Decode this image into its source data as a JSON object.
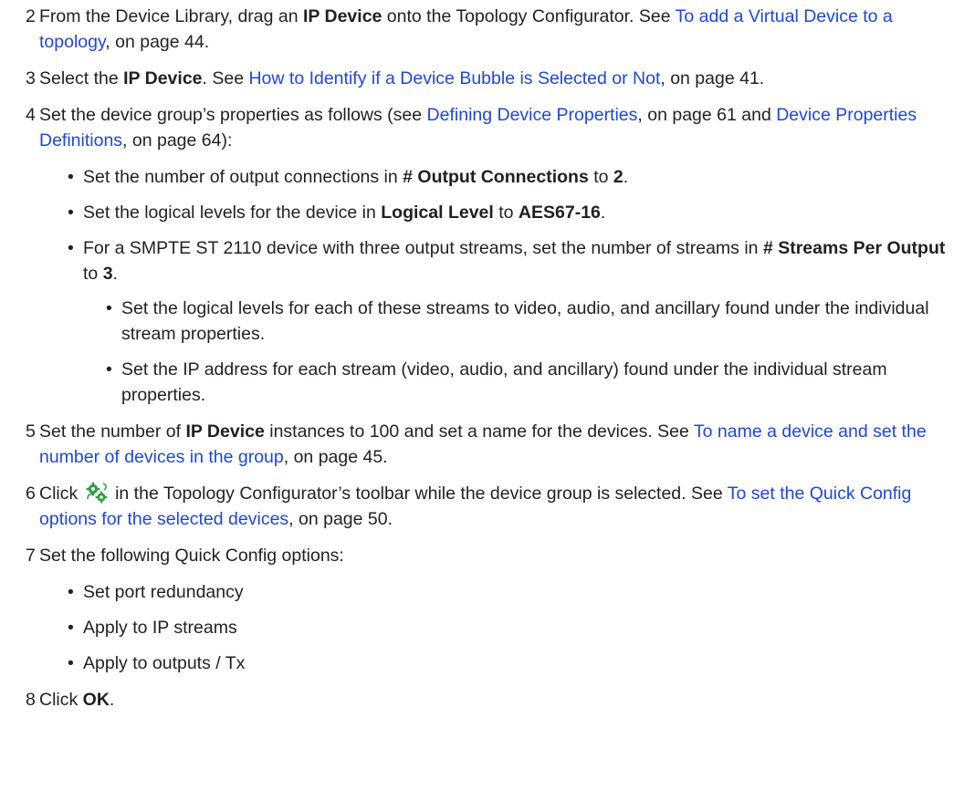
{
  "steps": [
    {
      "num": "2",
      "t1": "From the Device Library, drag an ",
      "b1": "IP Device",
      "t2": " onto the Topology Configurator. See ",
      "link": "To add a Virtual Device to a topology",
      "t3": ", on page 44."
    },
    {
      "num": "3",
      "t1": "Select the ",
      "b1": "IP Device",
      "t2": ". See ",
      "link": "How to Identify if a Device Bubble is Selected or Not",
      "t3": ", on page 41."
    },
    {
      "num": "4",
      "t1": "Set the device group’s properties as follows (see ",
      "link1": "Defining Device Properties",
      "t2": ", on page 61 and ",
      "link2": "Device Properties Definitions",
      "t3": ", on page 64):",
      "bullets": [
        {
          "t1": "Set the number of output connections in ",
          "b1": "# Output Connections",
          "t2": " to ",
          "b2": "2",
          "t3": "."
        },
        {
          "t1": "Set the logical levels for the device in ",
          "b1": "Logical Level",
          "t2": " to ",
          "b2": "AES67-16",
          "t3": "."
        },
        {
          "t1": "For a SMPTE ST 2110 device with three output streams, set the number of streams in ",
          "b1": "# Streams Per Output",
          "t2": " to ",
          "b2": "3",
          "t3": "."
        }
      ],
      "sub_bullets": [
        "Set the logical levels for each of these streams to video, audio, and ancillary found under the individual stream properties.",
        "Set the IP address for each stream (video, audio, and ancillary) found under the individual stream properties."
      ]
    },
    {
      "num": "5",
      "t1": "Set the number of ",
      "b1": "IP Device",
      "t2": " instances to 100 and set a name for the devices. See ",
      "link": "To name a device and set the number of devices in the group",
      "t3": ", on page 45."
    },
    {
      "num": "6",
      "t1": "Click ",
      "icon": "quick-config-icon",
      "t2": " in the Topology Configurator’s toolbar while the device group is selected. See ",
      "link": "To set the Quick Config options for the selected devices",
      "t3": ", on page 50."
    },
    {
      "num": "7",
      "t1": "Set the following Quick Config options:",
      "bullets": [
        "Set port redundancy",
        "Apply to IP streams",
        "Apply to outputs / Tx"
      ]
    },
    {
      "num": "8",
      "t1": "Click ",
      "b1": "OK",
      "t2": "."
    }
  ],
  "bullet_char": "•",
  "colors": {
    "text": "#231f20",
    "link": "#1f47d6"
  }
}
